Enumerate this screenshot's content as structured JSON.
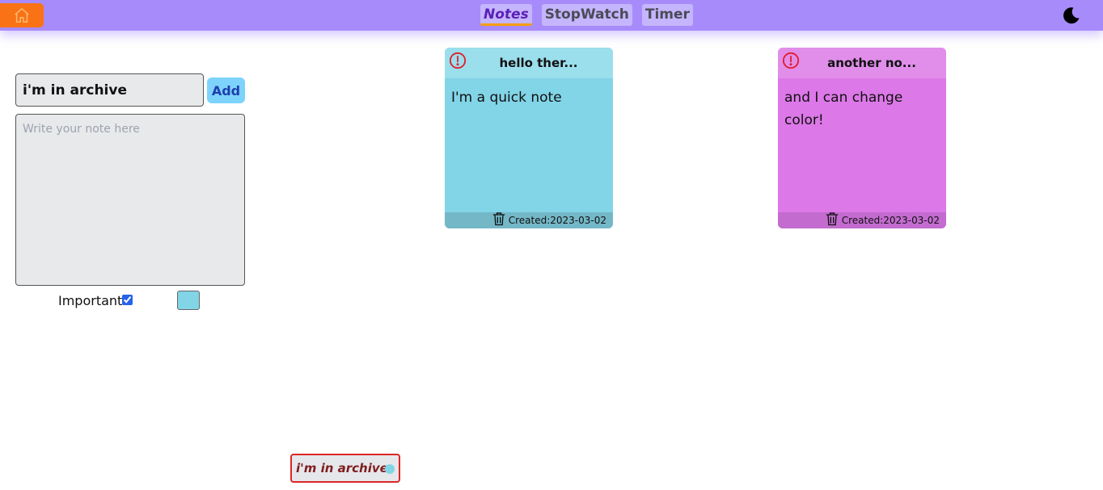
{
  "nav": {
    "tabs": [
      {
        "label": "Notes",
        "active": true
      },
      {
        "label": "StopWatch",
        "active": false
      },
      {
        "label": "Timer",
        "active": false
      }
    ],
    "icons": {
      "home": "home-icon",
      "theme": "moon-icon"
    }
  },
  "form": {
    "title_value": "i'm in archive",
    "add_label": "Add",
    "body_placeholder": "Write your note here",
    "important_label": "Important:",
    "important_checked": true,
    "selected_color": "#82d4e7"
  },
  "notes": [
    {
      "title": "hello ther...",
      "body": "I'm a quick note",
      "created": "Created:2023-03-02",
      "important": true,
      "color": "#82d4e7",
      "header_color": "#9bdeec",
      "footer_color": "#74b8c8"
    },
    {
      "title": "another no...",
      "body": "and I can change color!",
      "created": "Created:2023-03-02",
      "important": true,
      "color": "#dc78e8",
      "header_color": "#e18eea",
      "footer_color": "#c46bd0"
    }
  ],
  "archive": [
    {
      "title": "i'm in archive",
      "color": "#82d4e7"
    }
  ],
  "colors": {
    "navbar": "#a78bfa",
    "home": "#f97316",
    "accent": "#f59e0b",
    "alert": "#e11d2e"
  }
}
